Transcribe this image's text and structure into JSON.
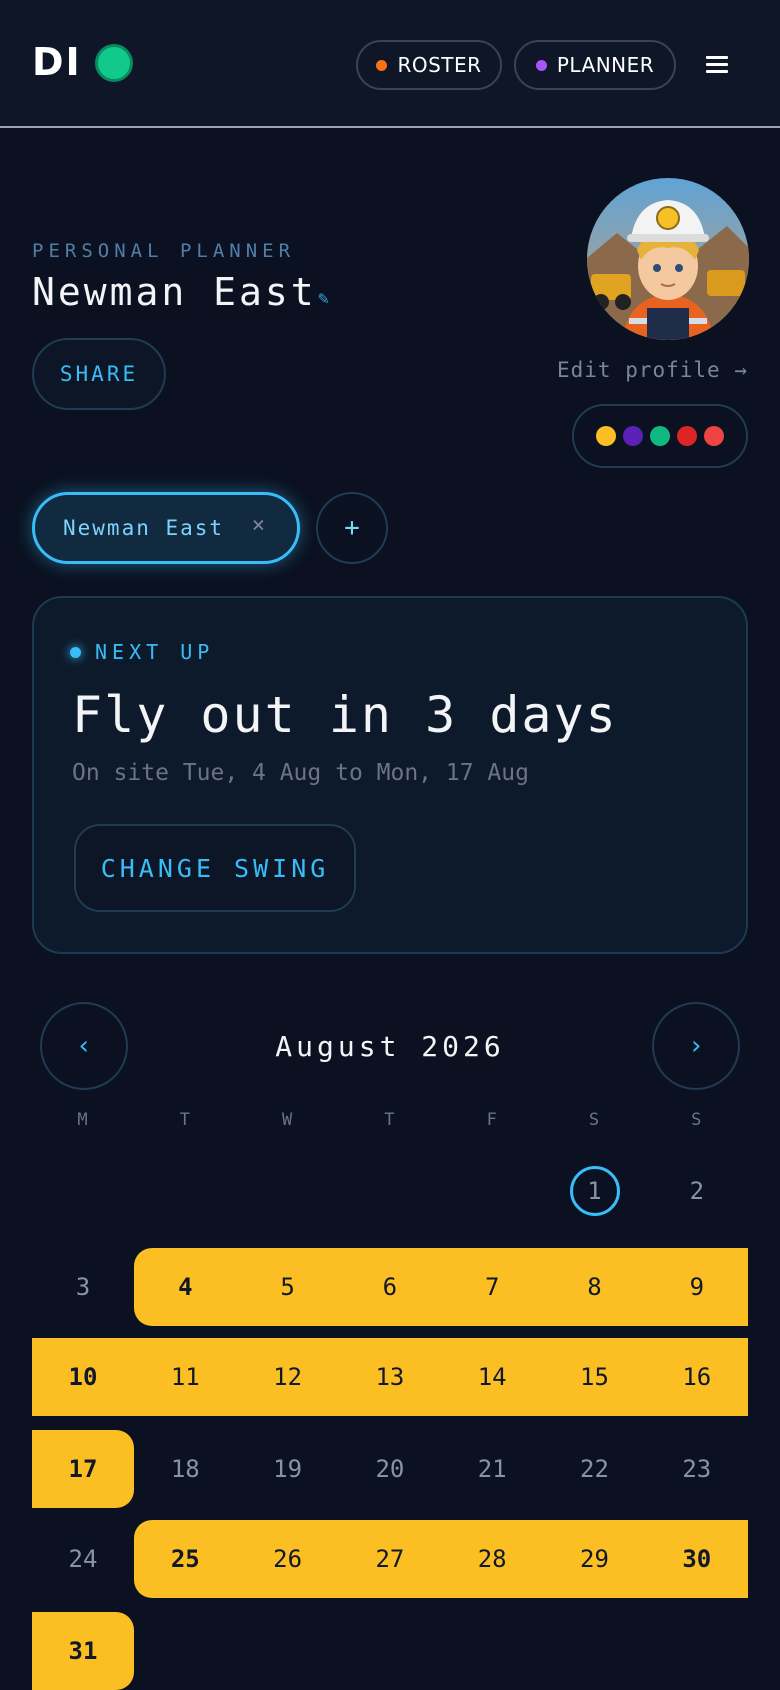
{
  "header": {
    "logo": "DI",
    "nav": [
      {
        "label": "ROSTER",
        "dot_color": "#f97316"
      },
      {
        "label": "PLANNER",
        "dot_color": "#a855f7"
      }
    ]
  },
  "profile": {
    "eyebrow": "PERSONAL PLANNER",
    "title": "Newman East",
    "share_label": "SHARE",
    "edit_profile_label": "Edit profile →",
    "swatches": [
      "#fbbf24",
      "#5b21b6",
      "#10b981",
      "#dc2626",
      "#ef4444"
    ]
  },
  "sites": {
    "active": "Newman East",
    "remove_glyph": "×",
    "add_glyph": "+"
  },
  "next_up": {
    "label": "NEXT UP",
    "title": "Fly out in 3 days",
    "subtitle": "On site Tue, 4 Aug to Mon, 17 Aug",
    "button": "CHANGE SWING"
  },
  "calendar": {
    "month_label": "August 2026",
    "prev_glyph": "‹",
    "next_glyph": "›",
    "weekdays": [
      "M",
      "T",
      "W",
      "T",
      "F",
      "S",
      "S"
    ],
    "today": 1,
    "on_site_days": [
      4,
      5,
      6,
      7,
      8,
      9,
      10,
      11,
      12,
      13,
      14,
      15,
      16,
      17,
      25,
      26,
      27,
      28,
      29,
      30,
      31
    ],
    "bold_days": [
      4,
      10,
      17,
      25,
      30,
      31
    ],
    "highlight_color": "#fbbf24"
  }
}
